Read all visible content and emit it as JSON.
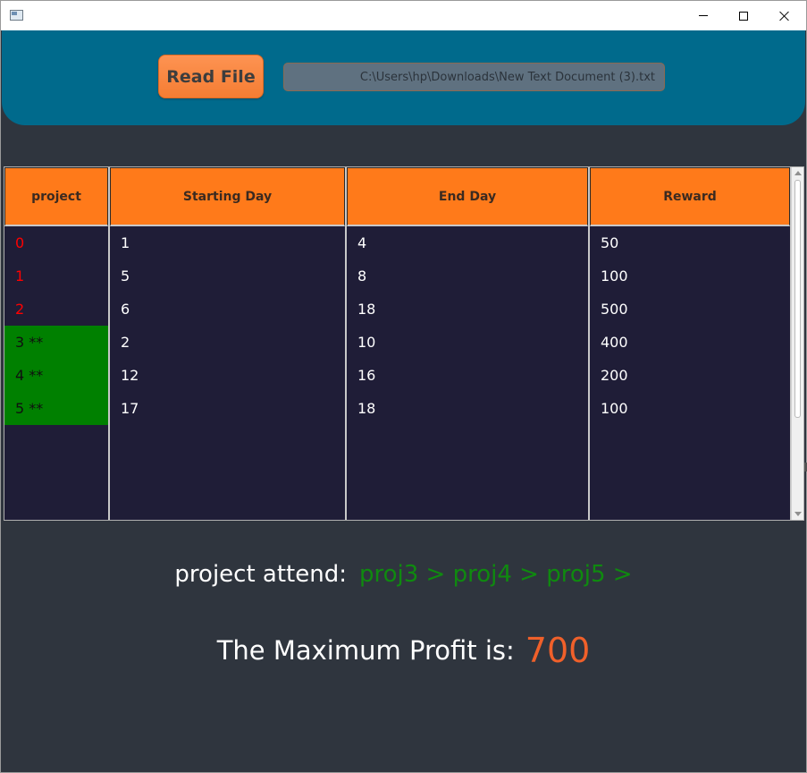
{
  "window": {
    "controls": {
      "minimize": "minimize",
      "maximize": "maximize",
      "close": "close"
    }
  },
  "toolbar": {
    "read_file_label": "Read File",
    "file_path": "C:\\Users\\hp\\Downloads\\New Text Document (3).txt"
  },
  "table": {
    "headers": {
      "project": "project",
      "start": "Starting Day",
      "end": "End Day",
      "reward": "Reward"
    },
    "rows": [
      {
        "project": "0",
        "start": "1",
        "end": "4",
        "reward": "50",
        "selected": false
      },
      {
        "project": "1",
        "start": "5",
        "end": "8",
        "reward": "100",
        "selected": false
      },
      {
        "project": "2",
        "start": "6",
        "end": "18",
        "reward": "500",
        "selected": false
      },
      {
        "project": "3 **",
        "start": "2",
        "end": "10",
        "reward": "400",
        "selected": true
      },
      {
        "project": "4 **",
        "start": "12",
        "end": "16",
        "reward": "200",
        "selected": true
      },
      {
        "project": "5 **",
        "start": "17",
        "end": "18",
        "reward": "100",
        "selected": true
      }
    ]
  },
  "result": {
    "attend_label": "project attend:",
    "attend_path": "proj3 > proj4 > proj5 >",
    "profit_label": "The Maximum Profit is:",
    "profit_value": "700"
  },
  "colors": {
    "header_bg": "#006a8c",
    "accent_orange": "#ff7a1a",
    "selected_green": "#008000",
    "unselected_red": "#ff0000",
    "profit_value": "#f0602a"
  }
}
